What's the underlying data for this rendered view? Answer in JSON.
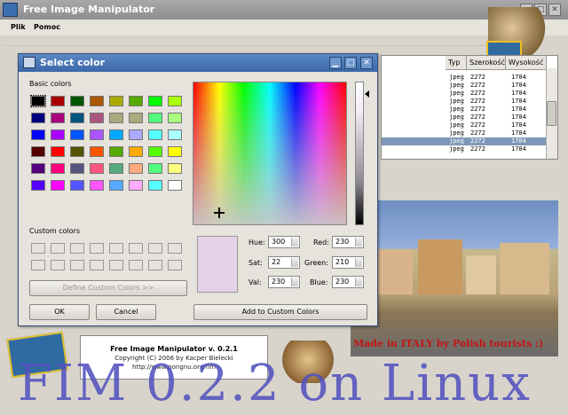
{
  "main_window": {
    "title": "Free Image Manipulator",
    "menu": [
      "Plik",
      "Pomoc"
    ]
  },
  "file_table": {
    "headers": [
      "Typ",
      "Szerokość",
      "Wysokość"
    ],
    "rows": [
      {
        "type": "jpeg",
        "width": "2272",
        "height": "1704",
        "selected": false
      },
      {
        "type": "jpeg",
        "width": "2272",
        "height": "1704",
        "selected": false
      },
      {
        "type": "jpeg",
        "width": "2272",
        "height": "1704",
        "selected": false
      },
      {
        "type": "jpeg",
        "width": "2272",
        "height": "1704",
        "selected": false
      },
      {
        "type": "jpeg",
        "width": "2272",
        "height": "1704",
        "selected": false
      },
      {
        "type": "jpeg",
        "width": "2272",
        "height": "1704",
        "selected": false
      },
      {
        "type": "jpeg",
        "width": "2272",
        "height": "1704",
        "selected": false
      },
      {
        "type": "jpeg",
        "width": "2272",
        "height": "1704",
        "selected": false
      },
      {
        "type": "jpeg",
        "width": "2272",
        "height": "1704",
        "selected": true
      },
      {
        "type": "jpeg",
        "width": "2272",
        "height": "1704",
        "selected": false
      }
    ]
  },
  "photo_caption": "Made in ITALY by Polish tourists :)",
  "about": {
    "line1": "Free Image Manipulator v. 0.2.1",
    "line2": "Copyright (C) 2006 by Kacper Bielecki",
    "line3": "http://www.nongnu.org/fim"
  },
  "overlay_title": "FIM 0.2.2 on Linux",
  "dialog": {
    "title": "Select color",
    "basic_colors_label": "Basic colors",
    "custom_colors_label": "Custom colors",
    "define_custom_button": "Define Custom Colors >>",
    "ok_button": "OK",
    "cancel_button": "Cancel",
    "add_custom_button": "Add to Custom Colors",
    "fields": {
      "hue": {
        "label": "Hue:",
        "value": "300"
      },
      "sat": {
        "label": "Sat:",
        "value": "22"
      },
      "val": {
        "label": "Val:",
        "value": "230"
      },
      "red": {
        "label": "Red:",
        "value": "230"
      },
      "green": {
        "label": "Green:",
        "value": "210"
      },
      "blue": {
        "label": "Blue:",
        "value": "230"
      }
    },
    "basic_colors": [
      "#000000",
      "#aa0000",
      "#005500",
      "#aa5500",
      "#aaaa00",
      "#55aa00",
      "#00ff00",
      "#aaff00",
      "#00007f",
      "#aa007f",
      "#00557f",
      "#aa557f",
      "#aaaa7f",
      "#aaaa7f",
      "#55ff7f",
      "#aaff7f",
      "#0000ff",
      "#aa00ff",
      "#0055ff",
      "#aa55ff",
      "#00aaff",
      "#aaaaff",
      "#55ffff",
      "#aaffff",
      "#550000",
      "#ff0000",
      "#555500",
      "#ff5500",
      "#55aa00",
      "#ffaa00",
      "#55ff00",
      "#ffff00",
      "#55007f",
      "#ff007f",
      "#55557f",
      "#ff557f",
      "#55aa7f",
      "#ffaa7f",
      "#55ff7f",
      "#ffff7f",
      "#5500ff",
      "#ff00ff",
      "#5555ff",
      "#ff55ff",
      "#55aaff",
      "#ffaaff",
      "#55ffff",
      "#ffffff"
    ],
    "selected_color": "#e6d2e6"
  }
}
